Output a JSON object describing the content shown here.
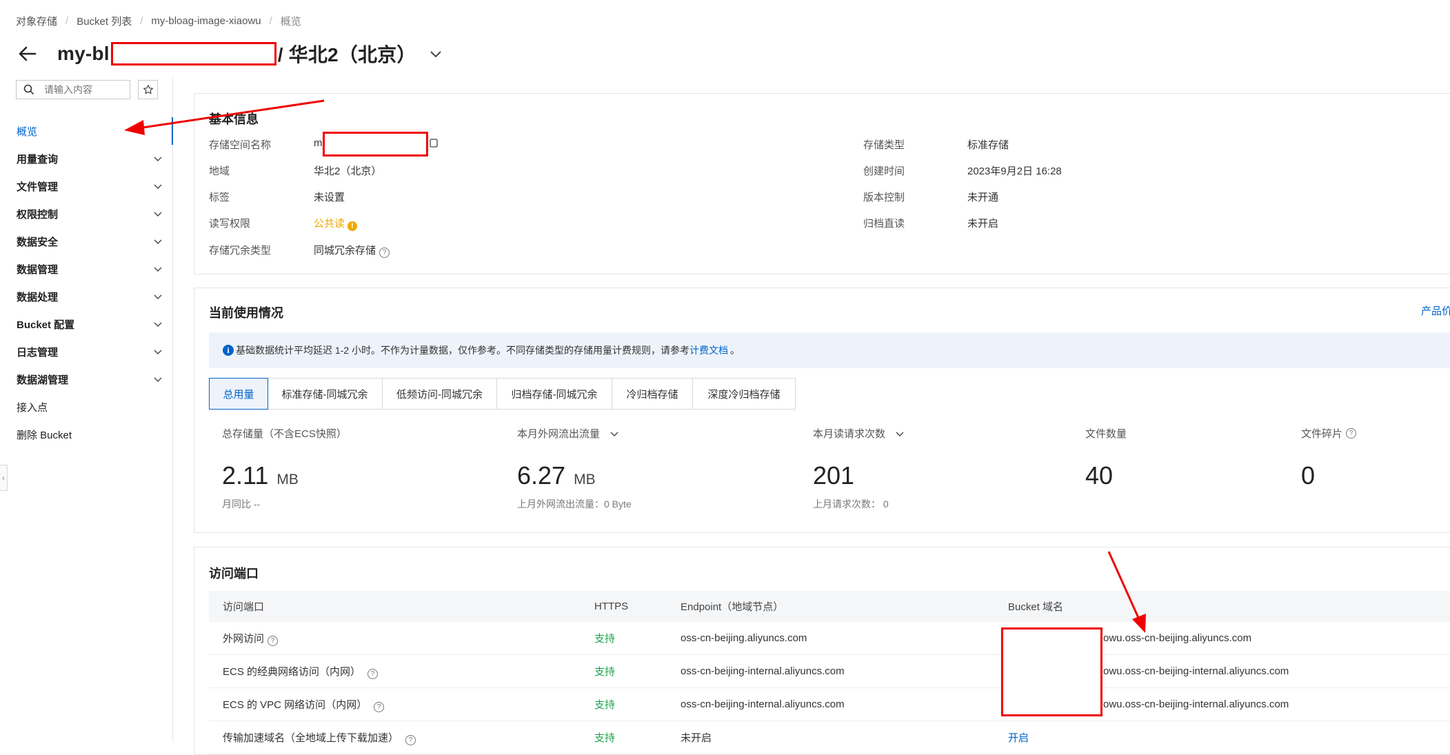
{
  "breadcrumb": [
    "对象存储",
    "Bucket 列表",
    "my-bloag-image-xiaowu",
    "概览"
  ],
  "title": {
    "prefix": "my-bl",
    "region": "/ 华北2（北京）"
  },
  "sidebar": {
    "search_placeholder": "请输入内容",
    "items": [
      {
        "label": "概览",
        "active": true,
        "expandable": false
      },
      {
        "label": "用量查询",
        "expandable": true
      },
      {
        "label": "文件管理",
        "expandable": true
      },
      {
        "label": "权限控制",
        "expandable": true
      },
      {
        "label": "数据安全",
        "expandable": true
      },
      {
        "label": "数据管理",
        "expandable": true
      },
      {
        "label": "数据处理",
        "expandable": true
      },
      {
        "label": "Bucket 配置",
        "expandable": true
      },
      {
        "label": "日志管理",
        "expandable": true
      },
      {
        "label": "数据湖管理",
        "expandable": true
      },
      {
        "label": "接入点",
        "expandable": false
      },
      {
        "label": "删除 Bucket",
        "expandable": false
      }
    ]
  },
  "basic_info": {
    "title": "基本信息",
    "left": [
      {
        "label": "存储空间名称",
        "value": "m"
      },
      {
        "label": "地域",
        "value": "华北2（北京）"
      },
      {
        "label": "标签",
        "value": "未设置"
      },
      {
        "label": "读写权限",
        "value": "公共读"
      },
      {
        "label": "存储冗余类型",
        "value": "同城冗余存储"
      }
    ],
    "right": [
      {
        "label": "存储类型",
        "value": "标准存储"
      },
      {
        "label": "创建时间",
        "value": "2023年9月2日 16:28"
      },
      {
        "label": "版本控制",
        "value": "未开通"
      },
      {
        "label": "归档直读",
        "value": "未开启"
      }
    ]
  },
  "usage": {
    "title": "当前使用情况",
    "right_link": "产品价",
    "notice_text": "基础数据统计平均延迟 1-2 小时。不作为计量数据，仅作参考。不同存储类型的存储用量计费规则，请参考",
    "notice_link": "计费文档",
    "notice_end": "。",
    "tabs": [
      "总用量",
      "标准存储-同城冗余",
      "低频访问-同城冗余",
      "归档存储-同城冗余",
      "冷归档存储",
      "深度冷归档存储"
    ],
    "metrics": [
      {
        "label": "总存储量（不含ECS快照）",
        "value": "2.11",
        "unit": "MB",
        "sub": "月同比  --"
      },
      {
        "label": "本月外网流出流量",
        "value": "6.27",
        "unit": "MB",
        "sub": "上月外网流出流量：0 Byte"
      },
      {
        "label": "本月读请求次数",
        "value": "201",
        "unit": "",
        "sub": "上月请求次数：  0"
      },
      {
        "label": "文件数量",
        "value": "40",
        "unit": "",
        "sub": ""
      },
      {
        "label": "文件碎片",
        "value": "0",
        "unit": "",
        "sub": ""
      }
    ]
  },
  "endpoints": {
    "title": "访问端口",
    "headers": [
      "访问端口",
      "HTTPS",
      "Endpoint（地域节点）",
      "Bucket 域名"
    ],
    "rows": [
      {
        "port": "外网访问",
        "https": "支持",
        "endpoint": "oss-cn-beijing.aliyuncs.com",
        "domain": "owu.oss-cn-beijing.aliyuncs.com"
      },
      {
        "port": "ECS 的经典网络访问（内网）",
        "https": "支持",
        "endpoint": "oss-cn-beijing-internal.aliyuncs.com",
        "domain": "owu.oss-cn-beijing-internal.aliyuncs.com"
      },
      {
        "port": "ECS 的 VPC 网络访问（内网）",
        "https": "支持",
        "endpoint": "oss-cn-beijing-internal.aliyuncs.com",
        "domain": "owu.oss-cn-beijing-internal.aliyuncs.com"
      },
      {
        "port": "传输加速域名（全地域上传下载加速）",
        "https": "支持",
        "endpoint": "未开启",
        "domain": "开启"
      }
    ]
  },
  "colors": {
    "accent": "#0064c8",
    "annotation": "#e00000",
    "success": "#1ba34a",
    "warning": "#f2a900"
  }
}
